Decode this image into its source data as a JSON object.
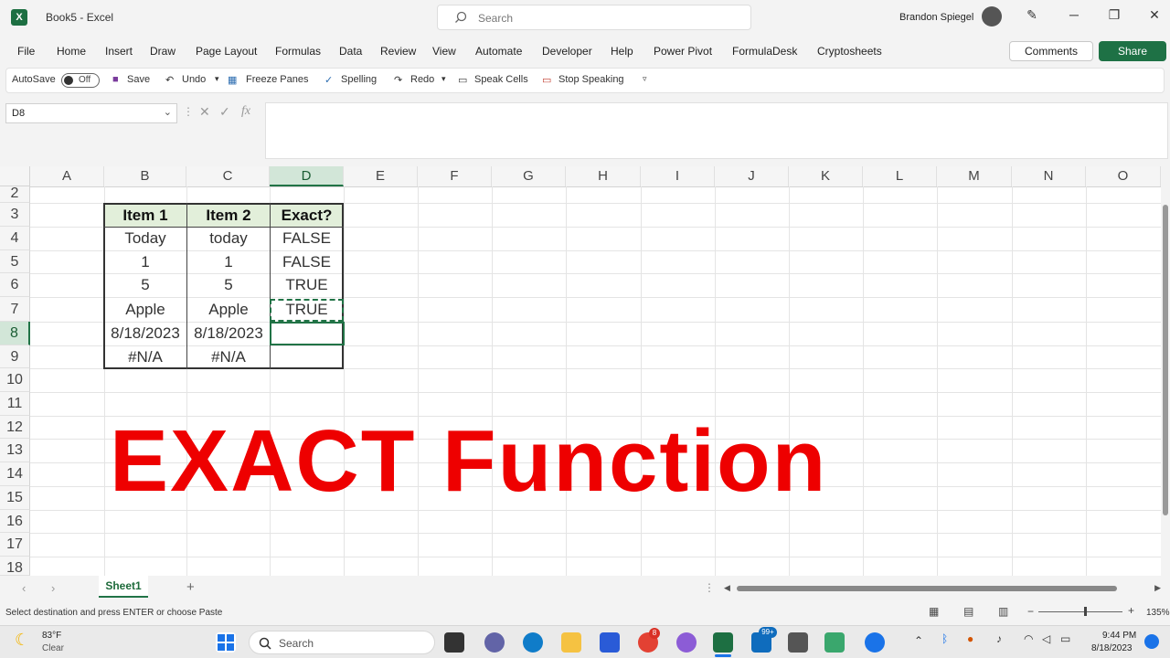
{
  "window": {
    "title": "Book5 - Excel",
    "search_placeholder": "Search",
    "user_name": "Brandon Spiegel"
  },
  "menu": [
    "File",
    "Home",
    "Insert",
    "Draw",
    "Page Layout",
    "Formulas",
    "Data",
    "Review",
    "View",
    "Automate",
    "Developer",
    "Help",
    "Power Pivot",
    "FormulaDesk",
    "Cryptosheets"
  ],
  "buttons": {
    "comments": "Comments",
    "share": "Share"
  },
  "qat": {
    "autosave": "AutoSave",
    "autosave_state": "Off",
    "save": "Save",
    "undo": "Undo",
    "freeze_panes": "Freeze Panes",
    "spelling": "Spelling",
    "redo": "Redo",
    "speak_cells": "Speak Cells",
    "stop_speaking": "Stop Speaking"
  },
  "formula_bar": {
    "name_box": "D8",
    "fx": "fx",
    "formula": ""
  },
  "columns": [
    "A",
    "B",
    "C",
    "D",
    "E",
    "F",
    "G",
    "H",
    "I",
    "J",
    "K",
    "L",
    "M",
    "N",
    "O"
  ],
  "selected_column": "D",
  "rows": [
    "2",
    "3",
    "4",
    "5",
    "6",
    "7",
    "8",
    "9",
    "10",
    "11",
    "12",
    "13",
    "14",
    "15",
    "16",
    "17",
    "18"
  ],
  "selected_row": "8",
  "table": {
    "headers": [
      "Item 1",
      "Item 2",
      "Exact?"
    ],
    "rows": [
      [
        "Today",
        "today",
        "FALSE"
      ],
      [
        "1",
        "1",
        "FALSE"
      ],
      [
        "5",
        "5",
        "TRUE"
      ],
      [
        "Apple",
        "Apple",
        "TRUE"
      ],
      [
        "8/18/2023",
        "8/18/2023",
        ""
      ],
      [
        "#N/A",
        "#N/A",
        ""
      ]
    ]
  },
  "overlay_title": "EXACT Function",
  "sheet_tab": "Sheet1",
  "status": {
    "message": "Select destination and press ENTER or choose Paste",
    "zoom": "135%"
  },
  "taskbar": {
    "weather_temp": "83°F",
    "weather_desc": "Clear",
    "search": "Search",
    "time": "9:44 PM",
    "date": "8/18/2023",
    "badge_mail": "99+",
    "badge_chrome": "8"
  },
  "colors": {
    "excel_green": "#217346",
    "share_green": "#1e7145",
    "header_fill": "#e2efda",
    "overlay_red": "#ee0000"
  }
}
